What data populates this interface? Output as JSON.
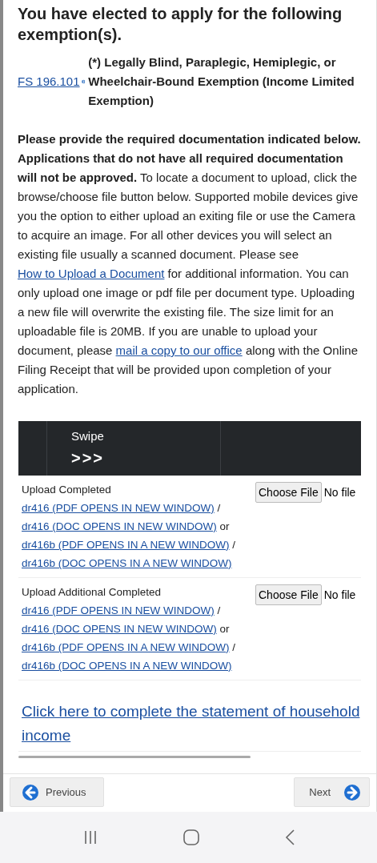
{
  "heading": "You have elected to apply for the following exemption(s).",
  "exemption": {
    "statute_link": "FS 196.101",
    "text": "(*) Legally Blind, Paraplegic, Hemiplegic, or Wheelchair-Bound Exemption (Income Limited Exemption)"
  },
  "instructions": [
    {
      "kind": "text",
      "text": "**Please provide the required documentation indicated below. Applications that do not have all required documentation will not be approved.** To locate a document to upload, click the browse/choose file button below. Supported mobile devices give you the option to either upload an exiting file or use the Camera to acquire an image. For all other devices you will select an existing file usually a scanned document. Please see "
    },
    {
      "kind": "link",
      "text": "How to Upload a Document"
    },
    {
      "kind": "text",
      "text": " for additional information. You can only upload one image or pdf file per document type. Uploading a new file will overwrite the existing file. The size limit for an uploadable file is 20MB. If you are unable to upload your document, please "
    },
    {
      "kind": "link",
      "text": "mail a copy to our office"
    },
    {
      "kind": "text",
      "text": " along with the Online Filing Receipt that will be provided upon completion of your application."
    }
  ],
  "swipe": {
    "label": "Swipe",
    "arrows": ">>>"
  },
  "uploads": [
    {
      "label": [
        {
          "kind": "text",
          "text": "Upload Completed "
        },
        {
          "kind": "link",
          "text": "dr416 (PDF OPENS IN NEW WINDOW)"
        },
        {
          "kind": "text",
          "text": " / "
        },
        {
          "kind": "link",
          "text": "dr416 (DOC OPENS IN NEW WINDOW)"
        },
        {
          "kind": "text",
          "text": " or "
        },
        {
          "kind": "link",
          "text": "dr416b (PDF OPENS IN A NEW WINDOW)"
        },
        {
          "kind": "text",
          "text": " / "
        },
        {
          "kind": "link",
          "text": "dr416b (DOC OPENS IN A NEW WINDOW)"
        }
      ],
      "button": "Choose File",
      "status": "No file"
    },
    {
      "label": [
        {
          "kind": "text",
          "text": "Upload Additional Completed "
        },
        {
          "kind": "link",
          "text": "dr416 (PDF OPENS IN NEW WINDOW)"
        },
        {
          "kind": "text",
          "text": " / "
        },
        {
          "kind": "link",
          "text": "dr416 (DOC OPENS IN NEW WINDOW)"
        },
        {
          "kind": "text",
          "text": " or "
        },
        {
          "kind": "link",
          "text": "dr416b (PDF OPENS IN A NEW WINDOW)"
        },
        {
          "kind": "text",
          "text": " / "
        },
        {
          "kind": "link",
          "text": "dr416b (DOC OPENS IN A NEW WINDOW)"
        }
      ],
      "button": "Choose File",
      "status": "No file"
    }
  ],
  "income_link": "Click here to complete the statement of household income",
  "nav": {
    "previous": "Previous",
    "next": "Next"
  }
}
